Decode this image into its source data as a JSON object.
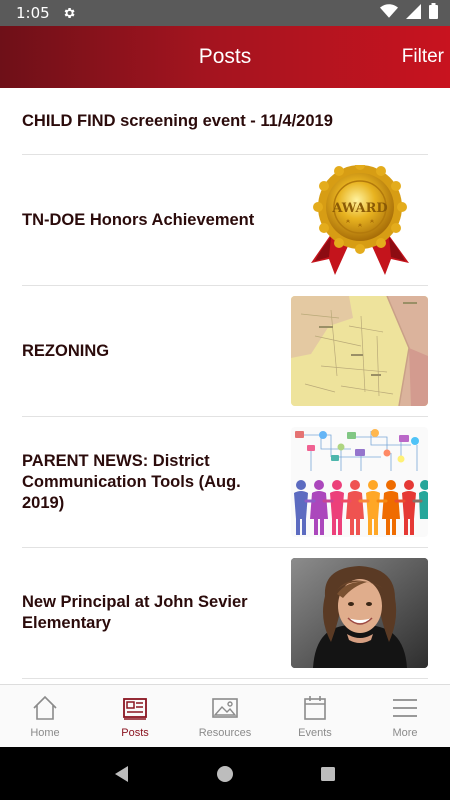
{
  "status_bar": {
    "time": "1:05",
    "icons": [
      "settings-gear-icon",
      "wifi-icon",
      "cell-signal-icon",
      "battery-icon"
    ]
  },
  "app_bar": {
    "title": "Posts",
    "filter_label": "Filter",
    "gradient_colors": [
      "#6e1018",
      "#c8131f"
    ]
  },
  "posts": [
    {
      "title": "CHILD FIND screening event - 11/4/2019",
      "thumbnail": null
    },
    {
      "title": "TN-DOE Honors Achievement",
      "thumbnail": "award-seal-image",
      "seal_text": "AWARD"
    },
    {
      "title": "REZONING",
      "thumbnail": "zoning-map-image"
    },
    {
      "title": "PARENT NEWS:  District Communication Tools  (Aug. 2019)",
      "thumbnail": "people-network-image"
    },
    {
      "title": "New Principal at John Sevier Elementary",
      "thumbnail": "principal-portrait-image"
    }
  ],
  "bottom_nav": {
    "active_color": "#8a1420",
    "items": [
      {
        "label": "Home",
        "icon": "home-icon"
      },
      {
        "label": "Posts",
        "icon": "newspaper-icon",
        "active": true
      },
      {
        "label": "Resources",
        "icon": "image-icon"
      },
      {
        "label": "Events",
        "icon": "calendar-icon"
      },
      {
        "label": "More",
        "icon": "menu-icon"
      }
    ]
  },
  "system_nav": [
    "back-icon",
    "home-circle-icon",
    "recents-square-icon"
  ]
}
